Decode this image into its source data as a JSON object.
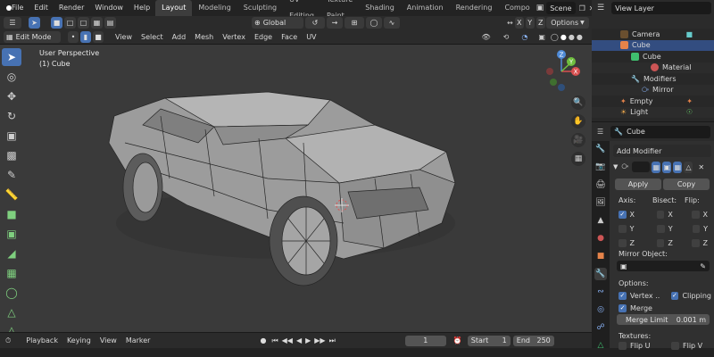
{
  "top_menu": {
    "items": [
      "File",
      "Edit",
      "Render",
      "Window",
      "Help"
    ],
    "workspaces": [
      "Layout",
      "Modeling",
      "Sculpting",
      "UV Editing",
      "Texture Paint",
      "Shading",
      "Animation",
      "Rendering",
      "Compo"
    ],
    "active_workspace": "Layout",
    "scene": "Scene",
    "view_layer": "View Layer"
  },
  "header2": {
    "orientation": "Global"
  },
  "header3": {
    "mode": "Edit Mode",
    "menus": [
      "View",
      "Select",
      "Add",
      "Mesh",
      "Vertex",
      "Edge",
      "Face",
      "UV"
    ],
    "options": "Options",
    "x": "X",
    "y": "Y",
    "z": "Z"
  },
  "viewport": {
    "title": "User Perspective",
    "object": "(1) Cube",
    "gizmo": {
      "x": "X",
      "y": "Y",
      "z": "Z"
    }
  },
  "timeline": {
    "menus": [
      "Playback",
      "Keying",
      "View",
      "Marker"
    ],
    "current_frame": "1",
    "start_label": "Start",
    "start": "1",
    "end_label": "End",
    "end": "250"
  },
  "outliner": {
    "rows": [
      {
        "label": "Camera",
        "indent": 1
      },
      {
        "label": "Cube",
        "indent": 1,
        "selected": true
      },
      {
        "label": "Cube",
        "indent": 2
      },
      {
        "label": "Material",
        "indent": 3
      },
      {
        "label": "Modifiers",
        "indent": 2
      },
      {
        "label": "Mirror",
        "indent": 3
      },
      {
        "label": "Empty",
        "indent": 1
      },
      {
        "label": "Light",
        "indent": 1
      }
    ]
  },
  "properties": {
    "object_name": "Cube",
    "add_modifier": "Add Modifier",
    "apply": "Apply",
    "copy": "Copy",
    "axis_label": "Axis:",
    "bisect_label": "Bisect:",
    "flip_label": "Flip:",
    "axes": [
      "X",
      "Y",
      "Z"
    ],
    "axis_states": [
      true,
      false,
      false
    ],
    "mirror_object_label": "Mirror Object:",
    "options_label": "Options:",
    "vertex_groups": "Vertex ..",
    "clipping": "Clipping",
    "merge": "Merge",
    "merge_limit_label": "Merge Limit",
    "merge_limit_value": "0.001 m",
    "textures_label": "Textures:",
    "flip_u": "Flip U",
    "flip_v": "Flip V"
  },
  "colors": {
    "accent_blue": "#4772b3",
    "selection": "#334d80",
    "viewport_bg": "#3a3a3a",
    "panel_bg": "#303030"
  }
}
